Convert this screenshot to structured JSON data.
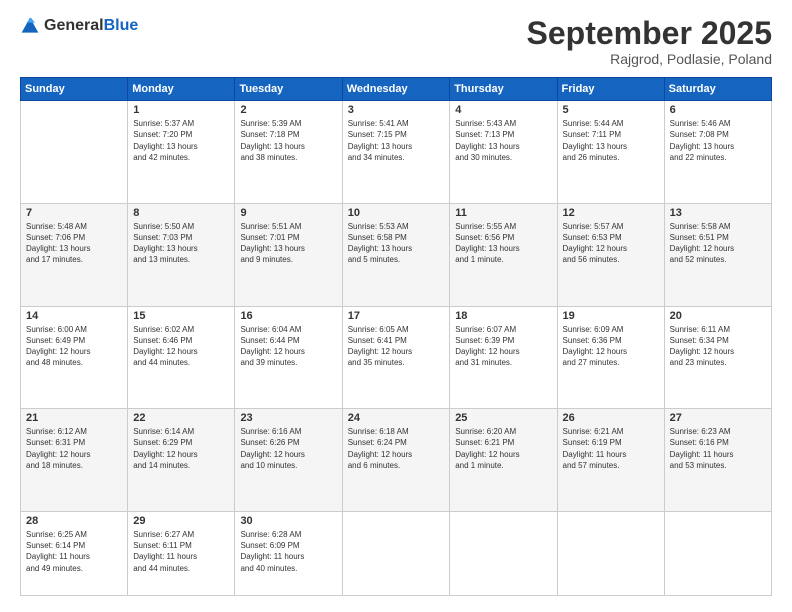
{
  "logo": {
    "general": "General",
    "blue": "Blue"
  },
  "header": {
    "month": "September 2025",
    "location": "Rajgrod, Podlasie, Poland"
  },
  "weekdays": [
    "Sunday",
    "Monday",
    "Tuesday",
    "Wednesday",
    "Thursday",
    "Friday",
    "Saturday"
  ],
  "weeks": [
    [
      {
        "day": "",
        "info": ""
      },
      {
        "day": "1",
        "info": "Sunrise: 5:37 AM\nSunset: 7:20 PM\nDaylight: 13 hours\nand 42 minutes."
      },
      {
        "day": "2",
        "info": "Sunrise: 5:39 AM\nSunset: 7:18 PM\nDaylight: 13 hours\nand 38 minutes."
      },
      {
        "day": "3",
        "info": "Sunrise: 5:41 AM\nSunset: 7:15 PM\nDaylight: 13 hours\nand 34 minutes."
      },
      {
        "day": "4",
        "info": "Sunrise: 5:43 AM\nSunset: 7:13 PM\nDaylight: 13 hours\nand 30 minutes."
      },
      {
        "day": "5",
        "info": "Sunrise: 5:44 AM\nSunset: 7:11 PM\nDaylight: 13 hours\nand 26 minutes."
      },
      {
        "day": "6",
        "info": "Sunrise: 5:46 AM\nSunset: 7:08 PM\nDaylight: 13 hours\nand 22 minutes."
      }
    ],
    [
      {
        "day": "7",
        "info": "Sunrise: 5:48 AM\nSunset: 7:06 PM\nDaylight: 13 hours\nand 17 minutes."
      },
      {
        "day": "8",
        "info": "Sunrise: 5:50 AM\nSunset: 7:03 PM\nDaylight: 13 hours\nand 13 minutes."
      },
      {
        "day": "9",
        "info": "Sunrise: 5:51 AM\nSunset: 7:01 PM\nDaylight: 13 hours\nand 9 minutes."
      },
      {
        "day": "10",
        "info": "Sunrise: 5:53 AM\nSunset: 6:58 PM\nDaylight: 13 hours\nand 5 minutes."
      },
      {
        "day": "11",
        "info": "Sunrise: 5:55 AM\nSunset: 6:56 PM\nDaylight: 13 hours\nand 1 minute."
      },
      {
        "day": "12",
        "info": "Sunrise: 5:57 AM\nSunset: 6:53 PM\nDaylight: 12 hours\nand 56 minutes."
      },
      {
        "day": "13",
        "info": "Sunrise: 5:58 AM\nSunset: 6:51 PM\nDaylight: 12 hours\nand 52 minutes."
      }
    ],
    [
      {
        "day": "14",
        "info": "Sunrise: 6:00 AM\nSunset: 6:49 PM\nDaylight: 12 hours\nand 48 minutes."
      },
      {
        "day": "15",
        "info": "Sunrise: 6:02 AM\nSunset: 6:46 PM\nDaylight: 12 hours\nand 44 minutes."
      },
      {
        "day": "16",
        "info": "Sunrise: 6:04 AM\nSunset: 6:44 PM\nDaylight: 12 hours\nand 39 minutes."
      },
      {
        "day": "17",
        "info": "Sunrise: 6:05 AM\nSunset: 6:41 PM\nDaylight: 12 hours\nand 35 minutes."
      },
      {
        "day": "18",
        "info": "Sunrise: 6:07 AM\nSunset: 6:39 PM\nDaylight: 12 hours\nand 31 minutes."
      },
      {
        "day": "19",
        "info": "Sunrise: 6:09 AM\nSunset: 6:36 PM\nDaylight: 12 hours\nand 27 minutes."
      },
      {
        "day": "20",
        "info": "Sunrise: 6:11 AM\nSunset: 6:34 PM\nDaylight: 12 hours\nand 23 minutes."
      }
    ],
    [
      {
        "day": "21",
        "info": "Sunrise: 6:12 AM\nSunset: 6:31 PM\nDaylight: 12 hours\nand 18 minutes."
      },
      {
        "day": "22",
        "info": "Sunrise: 6:14 AM\nSunset: 6:29 PM\nDaylight: 12 hours\nand 14 minutes."
      },
      {
        "day": "23",
        "info": "Sunrise: 6:16 AM\nSunset: 6:26 PM\nDaylight: 12 hours\nand 10 minutes."
      },
      {
        "day": "24",
        "info": "Sunrise: 6:18 AM\nSunset: 6:24 PM\nDaylight: 12 hours\nand 6 minutes."
      },
      {
        "day": "25",
        "info": "Sunrise: 6:20 AM\nSunset: 6:21 PM\nDaylight: 12 hours\nand 1 minute."
      },
      {
        "day": "26",
        "info": "Sunrise: 6:21 AM\nSunset: 6:19 PM\nDaylight: 11 hours\nand 57 minutes."
      },
      {
        "day": "27",
        "info": "Sunrise: 6:23 AM\nSunset: 6:16 PM\nDaylight: 11 hours\nand 53 minutes."
      }
    ],
    [
      {
        "day": "28",
        "info": "Sunrise: 6:25 AM\nSunset: 6:14 PM\nDaylight: 11 hours\nand 49 minutes."
      },
      {
        "day": "29",
        "info": "Sunrise: 6:27 AM\nSunset: 6:11 PM\nDaylight: 11 hours\nand 44 minutes."
      },
      {
        "day": "30",
        "info": "Sunrise: 6:28 AM\nSunset: 6:09 PM\nDaylight: 11 hours\nand 40 minutes."
      },
      {
        "day": "",
        "info": ""
      },
      {
        "day": "",
        "info": ""
      },
      {
        "day": "",
        "info": ""
      },
      {
        "day": "",
        "info": ""
      }
    ]
  ]
}
